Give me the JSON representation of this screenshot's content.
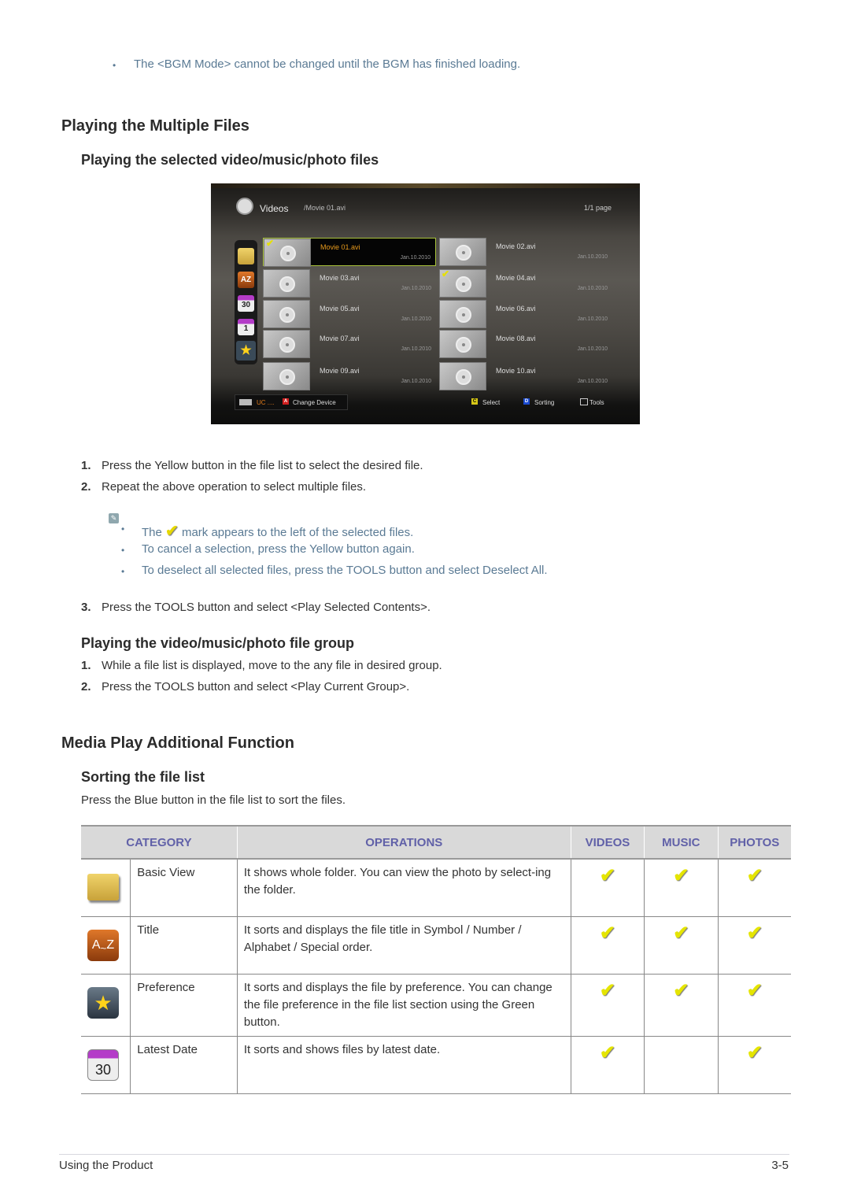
{
  "top_note": "The <BGM Mode> cannot be changed until the BGM has finished loading.",
  "section1": {
    "title": "Playing the Multiple Files",
    "subsection1": {
      "title": "Playing the selected video/music/photo files",
      "tv_screen": {
        "title": "Videos",
        "path": "/Movie 01.avi",
        "page": "1/1 page",
        "sidebar_icons": [
          "folder-icon",
          "a-z-icon",
          "calendar-30-icon",
          "calendar-1-icon",
          "star-icon"
        ],
        "files": [
          {
            "name": "Movie 01.avi",
            "date": "Jan.10.2010",
            "checked": true,
            "focused": true
          },
          {
            "name": "Movie 02.avi",
            "date": "Jan.10.2010",
            "checked": false,
            "focused": false
          },
          {
            "name": "Movie 03.avi",
            "date": "Jan.10.2010",
            "checked": false,
            "focused": false
          },
          {
            "name": "Movie 04.avi",
            "date": "Jan.10.2010",
            "checked": true,
            "focused": false
          },
          {
            "name": "Movie 05.avi",
            "date": "Jan.10.2010",
            "checked": false,
            "focused": false
          },
          {
            "name": "Movie 06.avi",
            "date": "Jan.10.2010",
            "checked": false,
            "focused": false
          },
          {
            "name": "Movie 07.avi",
            "date": "Jan.10.2010",
            "checked": false,
            "focused": false
          },
          {
            "name": "Movie 08.avi",
            "date": "Jan.10.2010",
            "checked": false,
            "focused": false
          },
          {
            "name": "Movie 09.avi",
            "date": "Jan.10.2010",
            "checked": false,
            "focused": false
          },
          {
            "name": "Movie 10.avi",
            "date": "Jan.10.2010",
            "checked": false,
            "focused": false
          }
        ],
        "footer": {
          "device": "UC ....",
          "key_a": "A",
          "change_device": "Change Device",
          "key_c": "C",
          "select": "Select",
          "key_d": "D",
          "sorting": "Sorting",
          "tools": "Tools"
        }
      },
      "steps": [
        {
          "num": "1.",
          "text": "Press the Yellow button in the file list to select the desired file."
        },
        {
          "num": "2.",
          "text": "Repeat the above operation to select multiple files."
        }
      ],
      "notes": {
        "note1_pre": "The",
        "note1_post": "mark appears to the left of the selected files.",
        "note2": "To cancel a selection, press the Yellow button again.",
        "note3": "To deselect all selected files, press the TOOLS button and select Deselect All."
      },
      "step3": {
        "num": "3.",
        "text": "Press the TOOLS button and select <Play Selected Contents>."
      }
    },
    "subsection2": {
      "title": "Playing the video/music/photo file group",
      "steps": [
        {
          "num": "1.",
          "text": "While a file list is displayed, move to the any file in desired group."
        },
        {
          "num": "2.",
          "text": "Press the TOOLS button and select <Play Current Group>."
        }
      ]
    }
  },
  "section2": {
    "title": "Media Play Additional Function",
    "subsection": {
      "title": "Sorting the file list",
      "intro": "Press the Blue button in the file list to sort the files.",
      "table": {
        "headers": [
          "CATEGORY",
          "OPERATIONS",
          "VIDEOS",
          "MUSIC",
          "PHOTOS"
        ],
        "rows": [
          {
            "icon": "folder-icon",
            "name": "Basic View",
            "operation": "It shows whole folder. You can view the photo by select-ing the folder.",
            "videos": "✔",
            "music": "✔",
            "photos": "✔"
          },
          {
            "icon": "a-z-icon",
            "name": "Title",
            "operation": "It sorts and displays the file title in Symbol / Number / Alphabet / Special order.",
            "videos": "✔",
            "music": "✔",
            "photos": "✔"
          },
          {
            "icon": "star-icon",
            "name": "Preference",
            "operation": "It sorts and displays the file by preference. You can change the file preference in the file list section using the Green button.",
            "videos": "✔",
            "music": "✔",
            "photos": "✔"
          },
          {
            "icon": "calendar-30-icon",
            "name": "Latest Date",
            "operation": "It sorts and shows files by latest date.",
            "videos": "✔",
            "music": "",
            "photos": "✔"
          }
        ]
      }
    }
  },
  "footer": {
    "left": "Using the Product",
    "right": "3-5"
  },
  "colors": {
    "note_text": "#5a7a94",
    "table_header_text": "#6161a8",
    "table_header_bg": "#d9d9d9",
    "check_yellow": "#e5e500",
    "tv_selected_text": "#e89a1c"
  }
}
